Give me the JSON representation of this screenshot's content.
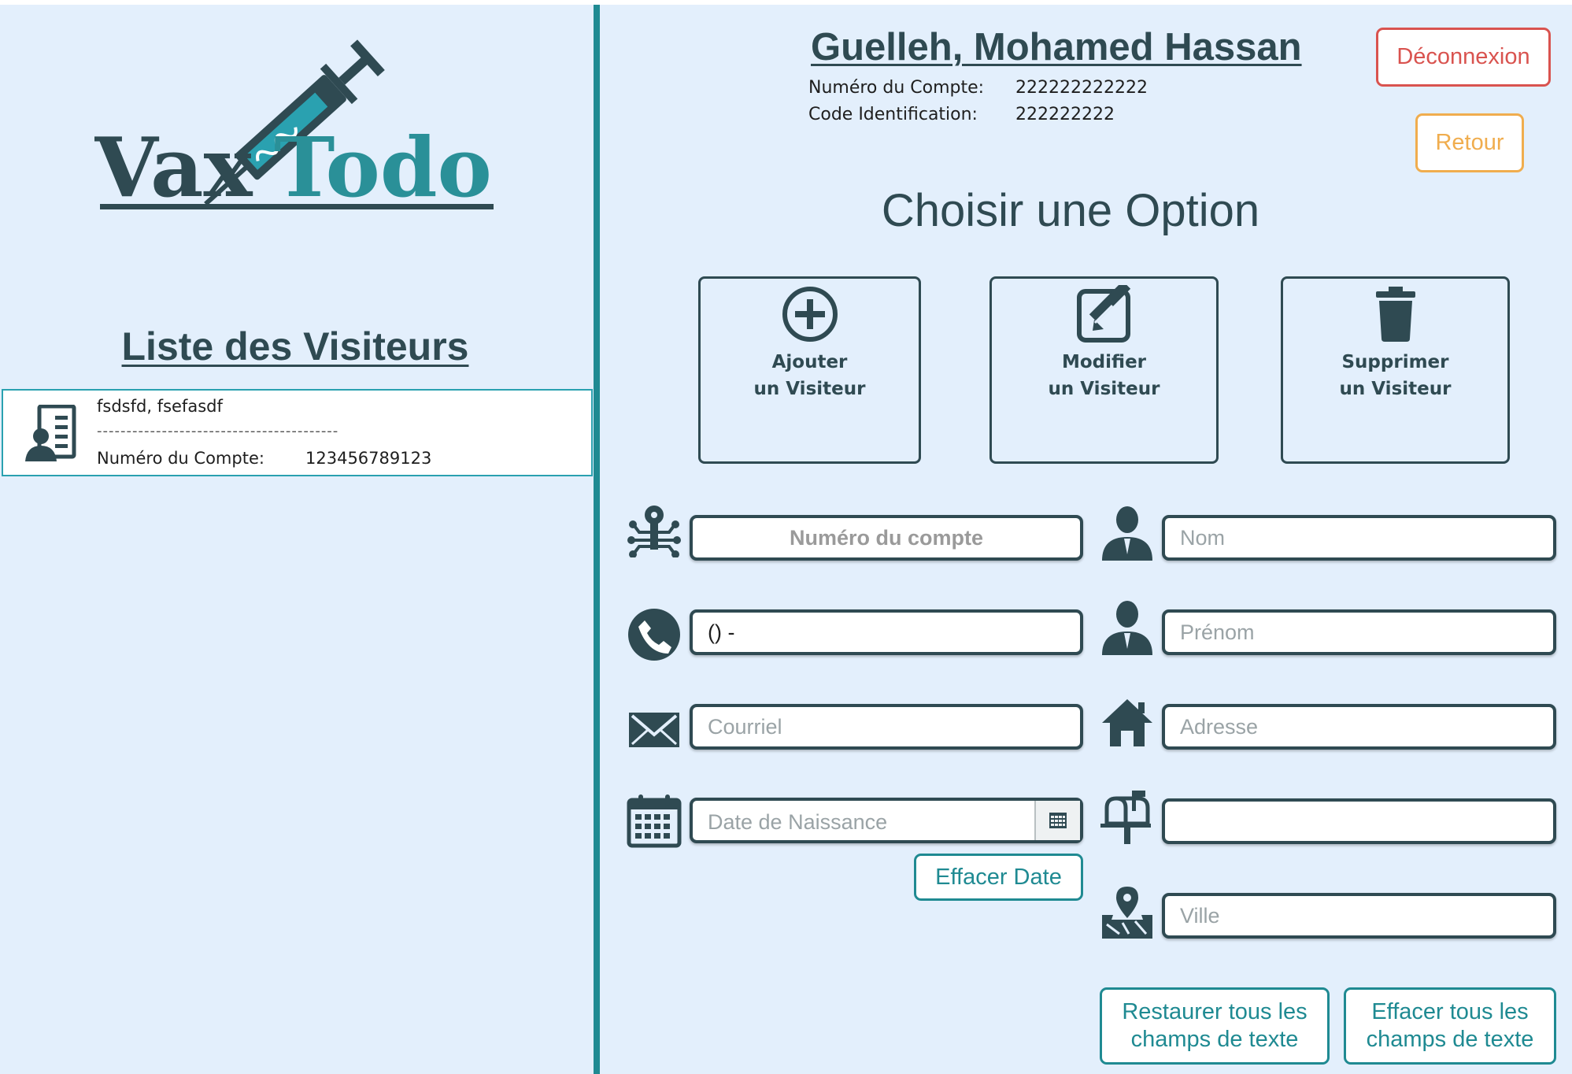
{
  "app": {
    "logo_text_left": "Vax",
    "logo_text_right": "Todo"
  },
  "sidebar": {
    "title": "Liste des Visiteurs",
    "visitors": [
      {
        "name": "fsdsfd, fsefasdf",
        "separator": "-----------------------------------------",
        "account_label": "Numéro du Compte:",
        "account_value": "123456789123"
      }
    ]
  },
  "header": {
    "user_name": "Guelleh, Mohamed Hassan",
    "account_label": "Numéro du Compte:",
    "account_value": "222222222222",
    "id_label": "Code Identification:",
    "id_value": "222222222",
    "logout_label": "Déconnexion",
    "back_label": "Retour"
  },
  "main": {
    "title": "Choisir une Option",
    "options": [
      {
        "line1": "Ajouter",
        "line2": "un Visiteur",
        "icon": "plus-circle-icon"
      },
      {
        "line1": "Modifier",
        "line2": "un Visiteur",
        "icon": "edit-icon"
      },
      {
        "line1": "Supprimer",
        "line2": "un Visiteur",
        "icon": "trash-icon"
      }
    ]
  },
  "form": {
    "account_number": {
      "value": "",
      "placeholder": "Numéro du compte"
    },
    "phone": {
      "value": "() -",
      "placeholder": ""
    },
    "email": {
      "value": "",
      "placeholder": "Courriel"
    },
    "birth_date": {
      "placeholder": "Date de Naissance"
    },
    "clear_date_label": "Effacer Date",
    "last_name": {
      "value": "",
      "placeholder": "Nom"
    },
    "first_name": {
      "value": "",
      "placeholder": "Prénom"
    },
    "address": {
      "value": "",
      "placeholder": "Adresse"
    },
    "postal_code": {
      "value": "",
      "placeholder": ""
    },
    "city": {
      "value": "",
      "placeholder": "Ville"
    },
    "restore_all_label": "Restaurer tous les champs de texte",
    "clear_all_label": "Effacer tous les champs de texte"
  },
  "colors": {
    "background": "#e3effc",
    "accent_teal": "#1f8a92",
    "dark_slate": "#2f4a52",
    "logout_red": "#d9534f",
    "back_orange": "#f0ad4e"
  }
}
